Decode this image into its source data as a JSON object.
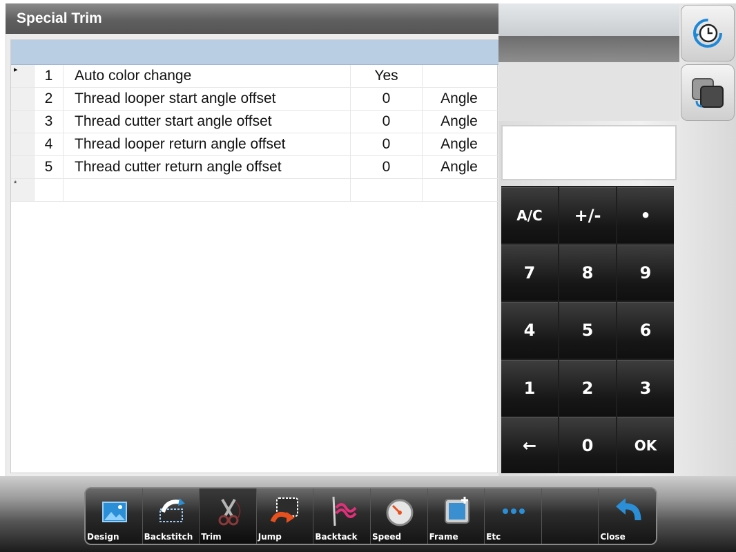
{
  "header": {
    "title": "Special Trim"
  },
  "table": {
    "rows": [
      {
        "marker": "▸",
        "no": "1",
        "name": "Auto color change",
        "value": "Yes",
        "unit": ""
      },
      {
        "marker": "",
        "no": "2",
        "name": "Thread looper start angle offset",
        "value": "0",
        "unit": "Angle"
      },
      {
        "marker": "",
        "no": "3",
        "name": "Thread cutter start angle offset",
        "value": "0",
        "unit": "Angle"
      },
      {
        "marker": "",
        "no": "4",
        "name": "Thread looper return angle offset",
        "value": "0",
        "unit": "Angle"
      },
      {
        "marker": "",
        "no": "5",
        "name": "Thread cutter return angle offset",
        "value": "0",
        "unit": "Angle"
      },
      {
        "marker": "*",
        "no": "",
        "name": "",
        "value": "",
        "unit": ""
      }
    ]
  },
  "side_buttons": [
    {
      "icon": "clock-refresh-icon"
    },
    {
      "icon": "window-switch-icon"
    }
  ],
  "input": {
    "value": ""
  },
  "keypad": {
    "keys": [
      "A/C",
      "+/-",
      "•",
      "7",
      "8",
      "9",
      "4",
      "5",
      "6",
      "1",
      "2",
      "3",
      "←",
      "0",
      "OK"
    ]
  },
  "toolbar": {
    "items": [
      {
        "label": "Design",
        "icon": "design-icon"
      },
      {
        "label": "Backstitch",
        "icon": "backstitch-icon"
      },
      {
        "label": "Trim",
        "icon": "scissors-icon",
        "active": true
      },
      {
        "label": "Jump",
        "icon": "jump-icon"
      },
      {
        "label": "Backtack",
        "icon": "backtack-icon"
      },
      {
        "label": "Speed",
        "icon": "speedometer-icon"
      },
      {
        "label": "Frame",
        "icon": "frame-icon"
      },
      {
        "label": "Etc",
        "icon": "more-icon"
      },
      {
        "label": "",
        "icon": ""
      },
      {
        "label": "Close",
        "icon": "undo-arrow-icon"
      }
    ]
  },
  "colors": {
    "header_bg": "#5f5f5f",
    "grid_header": "#b9cde3",
    "keypad_bg": "#1f1f1f",
    "accent_blue": "#1e88d8"
  }
}
